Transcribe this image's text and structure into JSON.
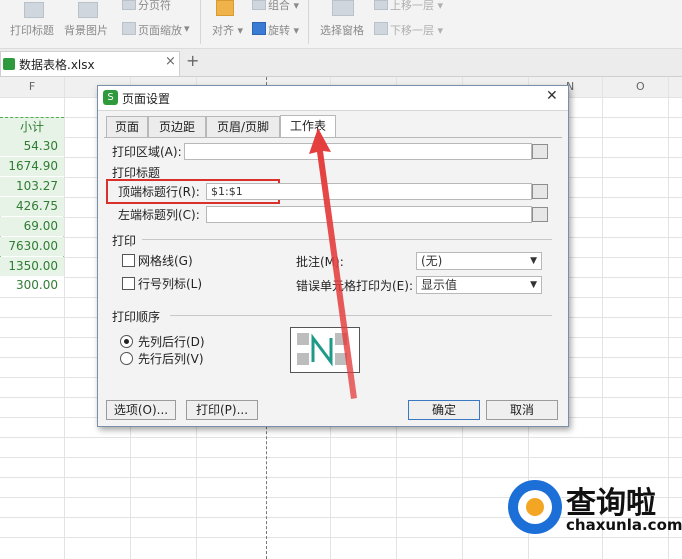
{
  "ribbon": {
    "print_titles": "打印标题",
    "background_image": "背景图片",
    "page_break": "分页符",
    "page_zoom": "页面缩放",
    "align": "对齐",
    "group": "组合",
    "rotate": "旋转",
    "selection_pane": "选择窗格",
    "bring_forward": "上移一层",
    "send_backward": "下移一层"
  },
  "file_tab": {
    "name": "数据表格.xlsx",
    "add": "+"
  },
  "sheet": {
    "col_f": "F",
    "col_n": "N",
    "col_o": "O",
    "header_cell": "小计",
    "values": [
      "54.30",
      "1674.90",
      "103.27",
      "426.75",
      "69.00",
      "7630.00",
      "1350.00",
      "300.00"
    ]
  },
  "dialog": {
    "title": "页面设置",
    "close": "✕",
    "tabs": [
      "页面",
      "页边距",
      "页眉/页脚",
      "工作表"
    ],
    "print_area_label": "打印区域(A):",
    "print_titles_group": "打印标题",
    "top_rows_label": "顶端标题行(R):",
    "top_rows_value": "$1:$1",
    "left_cols_label": "左端标题列(C):",
    "print_group": "打印",
    "gridlines_label": "网格线(G)",
    "row_col_headers_label": "行号列标(L)",
    "comments_label": "批注(M):",
    "comments_value": "(无)",
    "errors_label": "错误单元格打印为(E):",
    "errors_value": "显示值",
    "order_group": "打印顺序",
    "order_down_then_over": "先列后行(D)",
    "order_over_then_down": "先行后列(V)",
    "options_btn": "选项(O)...",
    "print_btn": "打印(P)...",
    "ok_btn": "确定",
    "cancel_btn": "取消"
  },
  "watermark": {
    "brand": "查询啦",
    "url": "chaxunla.com"
  },
  "colors": {
    "accent_green": "#2e7d32",
    "highlight_red": "#d9302c",
    "brand_blue": "#1d6fd8"
  }
}
